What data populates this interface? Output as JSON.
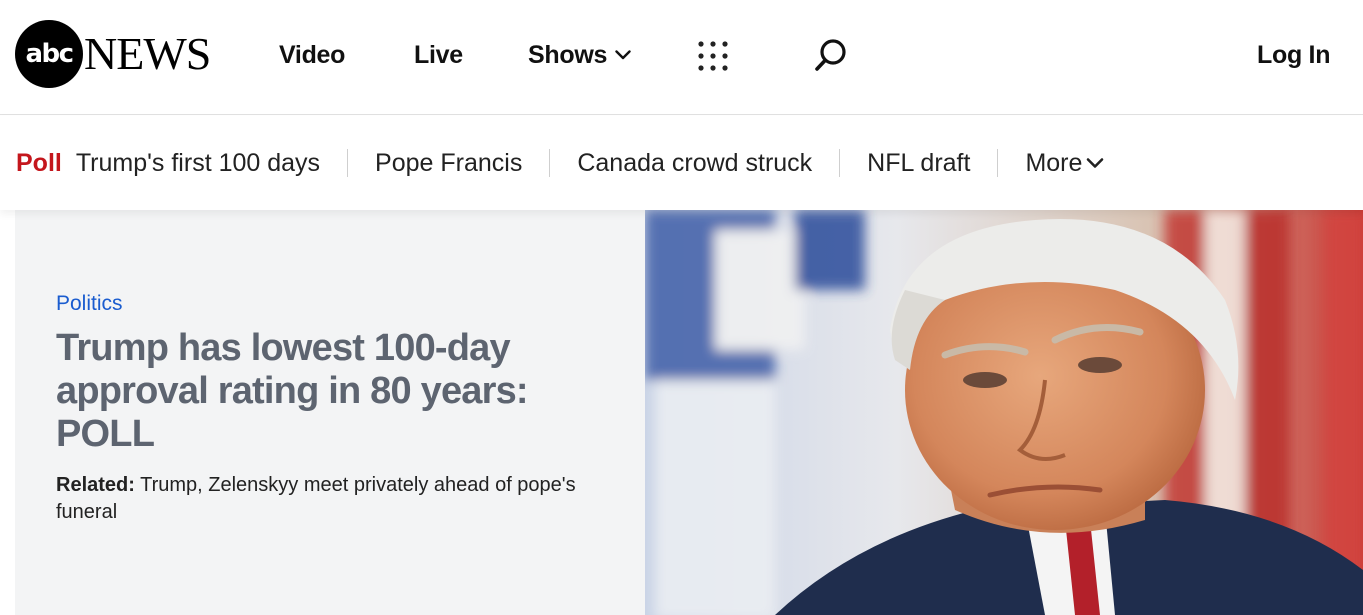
{
  "header": {
    "logo": {
      "mark": "abc",
      "word": "NEWS"
    },
    "nav": {
      "video": "Video",
      "live": "Live",
      "shows": "Shows"
    },
    "icons": {
      "shows_chevron": "chevron-down-icon",
      "apps": "grid-dots-icon",
      "search": "search-icon"
    },
    "login": "Log In"
  },
  "trending": {
    "label": "Poll",
    "items": [
      "Trump's first 100 days",
      "Pope Francis",
      "Canada crowd struck",
      "NFL draft"
    ],
    "more": "More",
    "colors": {
      "label": "#c4161c"
    }
  },
  "hero": {
    "category": "Politics",
    "headline": "Trump has lowest 100-day approval rating in 80 years: POLL",
    "related_label": "Related:",
    "related_text": "Trump, Zelenskyy meet privately ahead of pope's funeral",
    "colors": {
      "category": "#1a5ccf",
      "headline": "#5d6470",
      "card_bg": "#f3f4f5"
    }
  }
}
